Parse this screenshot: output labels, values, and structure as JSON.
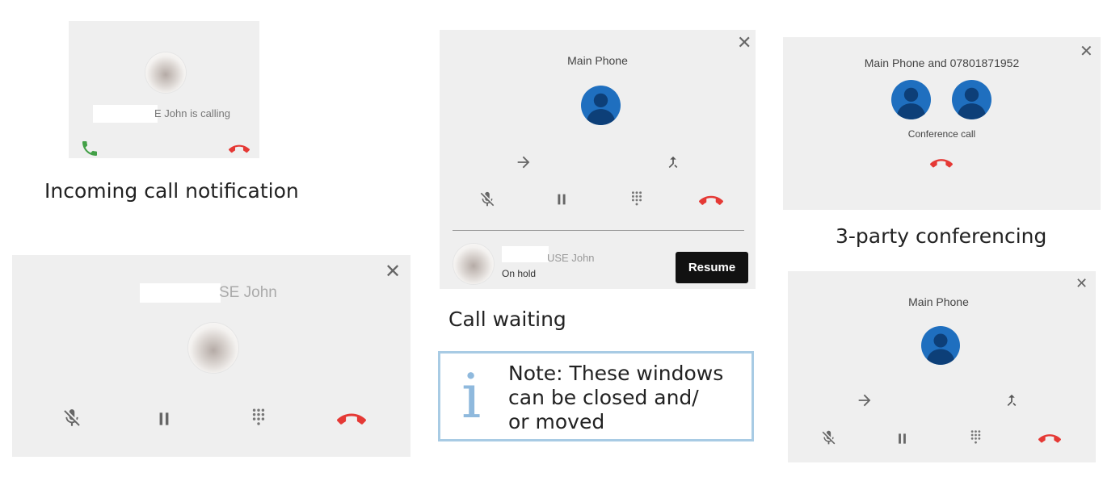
{
  "incoming_call": {
    "caller_text": "E John is calling",
    "caption": "Incoming call notification"
  },
  "active_call": {
    "name": "SE John",
    "close_glyph": "✕"
  },
  "call_waiting": {
    "title": "Main Phone",
    "held_name": "USE John",
    "held_status": "On hold",
    "resume_label": "Resume",
    "caption": "Call waiting",
    "close_glyph": "✕"
  },
  "note": {
    "icon_glyph": "i",
    "text": "Note: These windows\ncan be closed and/\nor moved"
  },
  "conference": {
    "title": "Main Phone and 07801871952",
    "status": "Conference call",
    "caption": "3-party conferencing",
    "close_glyph": "✕"
  },
  "transfer_call": {
    "title": "Main Phone",
    "close_glyph": "✕"
  },
  "icons": {
    "answer": "phone-answer-icon",
    "hangup": "hang-up-icon",
    "mute": "microphone-off-icon",
    "hold": "pause-icon",
    "keypad": "dialpad-icon",
    "transfer": "arrow-right-icon",
    "merge": "call-merge-icon",
    "contact": "person-icon"
  },
  "colors": {
    "panel_bg": "#efefef",
    "answer_green": "#43a047",
    "hangup_red": "#e53935",
    "avatar_blue": "#1f6fbf",
    "note_border": "#a8cbe4",
    "resume_bg": "#111111"
  }
}
